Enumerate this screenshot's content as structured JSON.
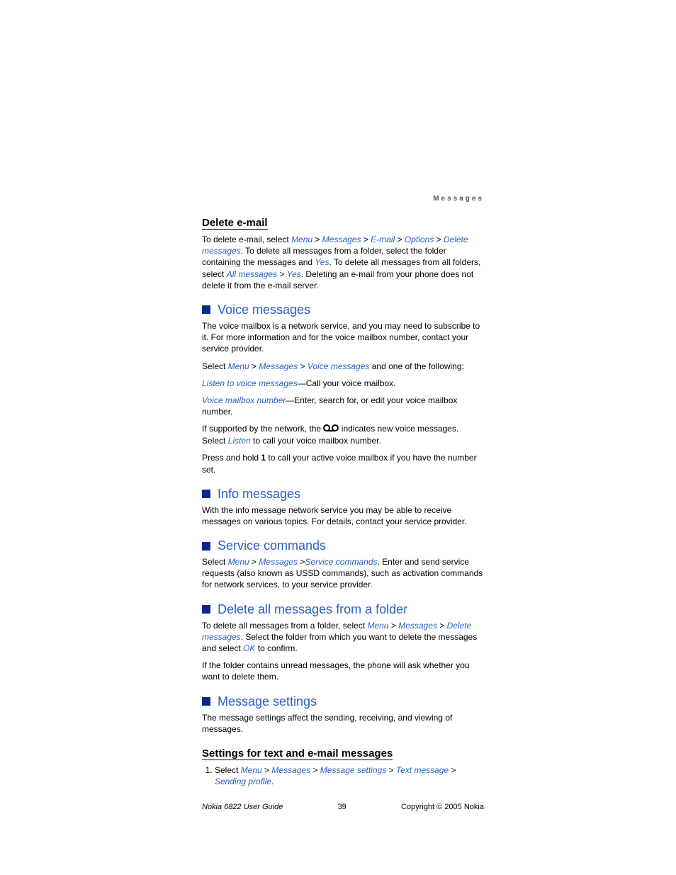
{
  "header": {
    "section": "Messages"
  },
  "deleteEmail": {
    "title": "Delete e-mail",
    "p1a": "To delete e-mail, select ",
    "nav": [
      "Menu",
      "Messages",
      "E-mail",
      "Options",
      "Delete messages"
    ],
    "p1b": ". To delete all messages from a folder, select the folder containing the messages and ",
    "yes": "Yes",
    "p1c": ". To delete all messages from all folders, select ",
    "all": "All messages",
    "p1d": ". Deleting an e-mail from your phone does not delete it from the e-mail server."
  },
  "voice": {
    "title": "Voice messages",
    "p1": "The voice mailbox is a network service, and you may need to subscribe to it. For more information and for the voice mailbox number, contact your service provider.",
    "p2a": "Select ",
    "nav": [
      "Menu",
      "Messages",
      "Voice messages"
    ],
    "p2b": " and one of the following:",
    "listen": "Listen to voice messages",
    "listenTxt": "—Call your voice mailbox.",
    "vmbox": "Voice mailbox number",
    "vmboxTxt": "—Enter, search for, or edit your voice mailbox number.",
    "p3a": "If supported by the network, the ",
    "p3b": " indicates new voice messages. Select ",
    "listenBtn": "Listen",
    "p3c": " to call your voice mailbox number.",
    "p4a": "Press and hold ",
    "key1": "1",
    "p4b": " to call your active voice mailbox if you have the number set."
  },
  "info": {
    "title": "Info messages",
    "p1": "With the info message network service you may be able to receive messages on various topics. For details, contact your service provider."
  },
  "service": {
    "title": "Service commands",
    "p1a": "Select ",
    "nav": [
      "Menu",
      "Messages",
      "Service commands"
    ],
    "p1b": ". Enter and send service requests (also known as USSD commands), such as activation commands for network services, to your service provider."
  },
  "deleteAll": {
    "title": "Delete all messages from a folder",
    "p1a": "To delete all messages from a folder, select ",
    "nav": [
      "Menu",
      "Messages",
      "Delete messages"
    ],
    "p1b": ". Select the folder from which you want to delete the messages and select ",
    "ok": "OK",
    "p1c": " to confirm.",
    "p2": "If the folder contains unread messages, the phone will ask whether you want to delete them."
  },
  "msgSettings": {
    "title": "Message settings",
    "p1": "The message settings affect the sending, receiving, and viewing of messages.",
    "subTitle": "Settings for text and e-mail messages",
    "step1a": "Select ",
    "nav": [
      "Menu",
      "Messages",
      "Message settings",
      "Text message",
      "Sending profile"
    ],
    "step1b": "."
  },
  "footer": {
    "guide": "Nokia 6822 User Guide",
    "page": "39",
    "copyright": "Copyright © 2005 Nokia"
  },
  "gt": ">"
}
